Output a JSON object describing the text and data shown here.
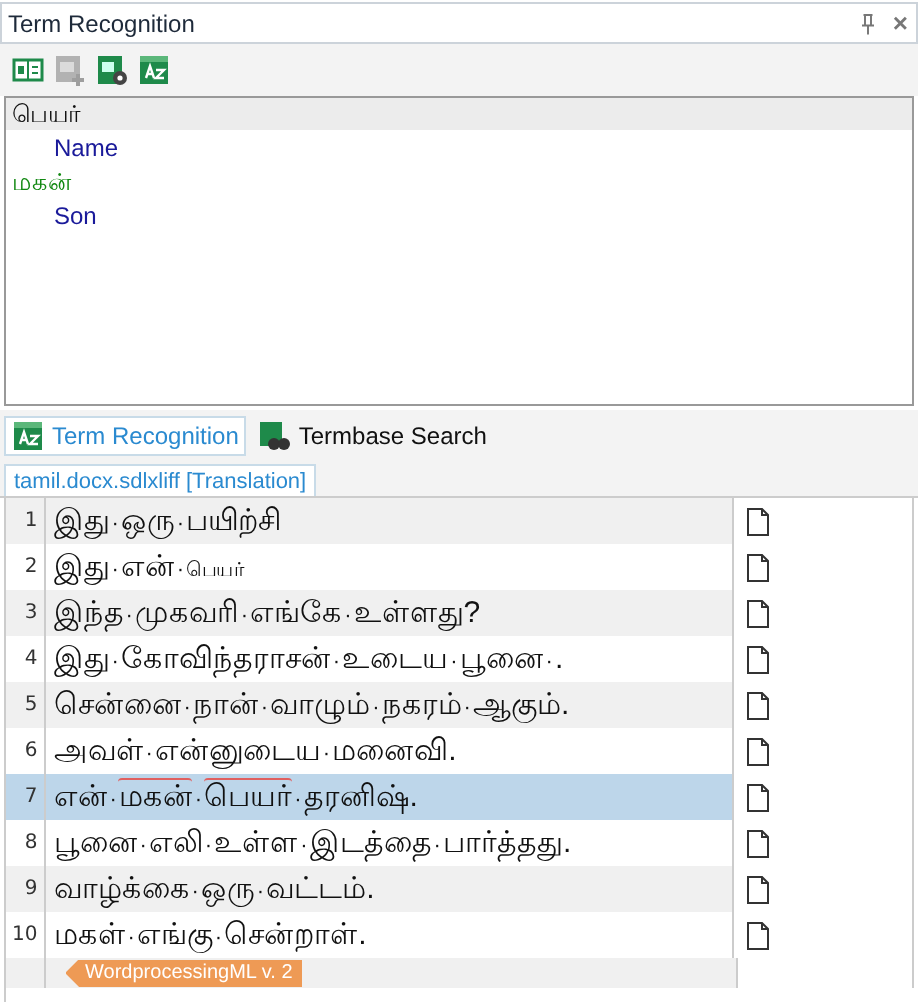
{
  "panel": {
    "title": "Term Recognition",
    "close": "×"
  },
  "toolbar": [
    {
      "kind": "book",
      "disabled": false
    },
    {
      "kind": "add",
      "disabled": true
    },
    {
      "kind": "settings",
      "disabled": false
    },
    {
      "kind": "az",
      "disabled": false
    }
  ],
  "terms": [
    {
      "text": "பெயர்",
      "selected": true,
      "children": [
        {
          "text": "Name"
        }
      ]
    },
    {
      "text": "மகன்",
      "selected": false,
      "children": [
        {
          "text": "Son"
        }
      ]
    }
  ],
  "tabs": [
    {
      "label": "Term Recognition",
      "kind": "az",
      "selected": true
    },
    {
      "label": "Termbase Search",
      "kind": "search",
      "selected": false
    }
  ],
  "document_tab": {
    "label": "tamil.docx.sdlxliff [Translation]"
  },
  "editor": {
    "space_mark": "·",
    "rows": [
      {
        "number": "1",
        "selected": false,
        "words": [
          {
            "text": "இது"
          },
          {
            "text": "ஒரு"
          },
          {
            "text": "பயிற்சி"
          }
        ]
      },
      {
        "number": "2",
        "selected": false,
        "words": [
          {
            "text": "இது"
          },
          {
            "text": "என்"
          },
          {
            "text": "பெயர்",
            "small": true
          }
        ]
      },
      {
        "number": "3",
        "selected": false,
        "words": [
          {
            "text": "இந்த"
          },
          {
            "text": "முகவரி"
          },
          {
            "text": "எங்கே"
          },
          {
            "text": "உள்ளது?"
          }
        ]
      },
      {
        "number": "4",
        "selected": false,
        "words": [
          {
            "text": "இது"
          },
          {
            "text": "கோவிந்தராசன்"
          },
          {
            "text": "உடைய"
          },
          {
            "text": "பூனை"
          },
          {
            "text": "."
          }
        ]
      },
      {
        "number": "5",
        "selected": false,
        "words": [
          {
            "text": "சென்னை"
          },
          {
            "text": "நான்"
          },
          {
            "text": "வாழும்"
          },
          {
            "text": "நகரம்"
          },
          {
            "text": "ஆகும்."
          }
        ]
      },
      {
        "number": "6",
        "selected": false,
        "words": [
          {
            "text": "அவள்"
          },
          {
            "text": "என்னுடைய"
          },
          {
            "text": "மனைவி."
          }
        ]
      },
      {
        "number": "7",
        "selected": true,
        "words": [
          {
            "text": "என்"
          },
          {
            "text": "மகன்",
            "term": true
          },
          {
            "text": "பெயர்",
            "term": true
          },
          {
            "text": "தரனிஷ்."
          }
        ]
      },
      {
        "number": "8",
        "selected": false,
        "words": [
          {
            "text": "பூனை"
          },
          {
            "text": "எலி"
          },
          {
            "text": "உள்ள"
          },
          {
            "text": "இடத்தை"
          },
          {
            "text": "பார்த்தது."
          }
        ]
      },
      {
        "number": "9",
        "selected": false,
        "words": [
          {
            "text": "வாழ்க்கை"
          },
          {
            "text": "ஒரு"
          },
          {
            "text": "வட்டம்."
          }
        ]
      },
      {
        "number": "10",
        "selected": false,
        "words": [
          {
            "text": "மகள்"
          },
          {
            "text": "எங்கு"
          },
          {
            "text": "சென்றாள்."
          }
        ]
      }
    ],
    "end_tag": "WordprocessingML v. 2"
  }
}
